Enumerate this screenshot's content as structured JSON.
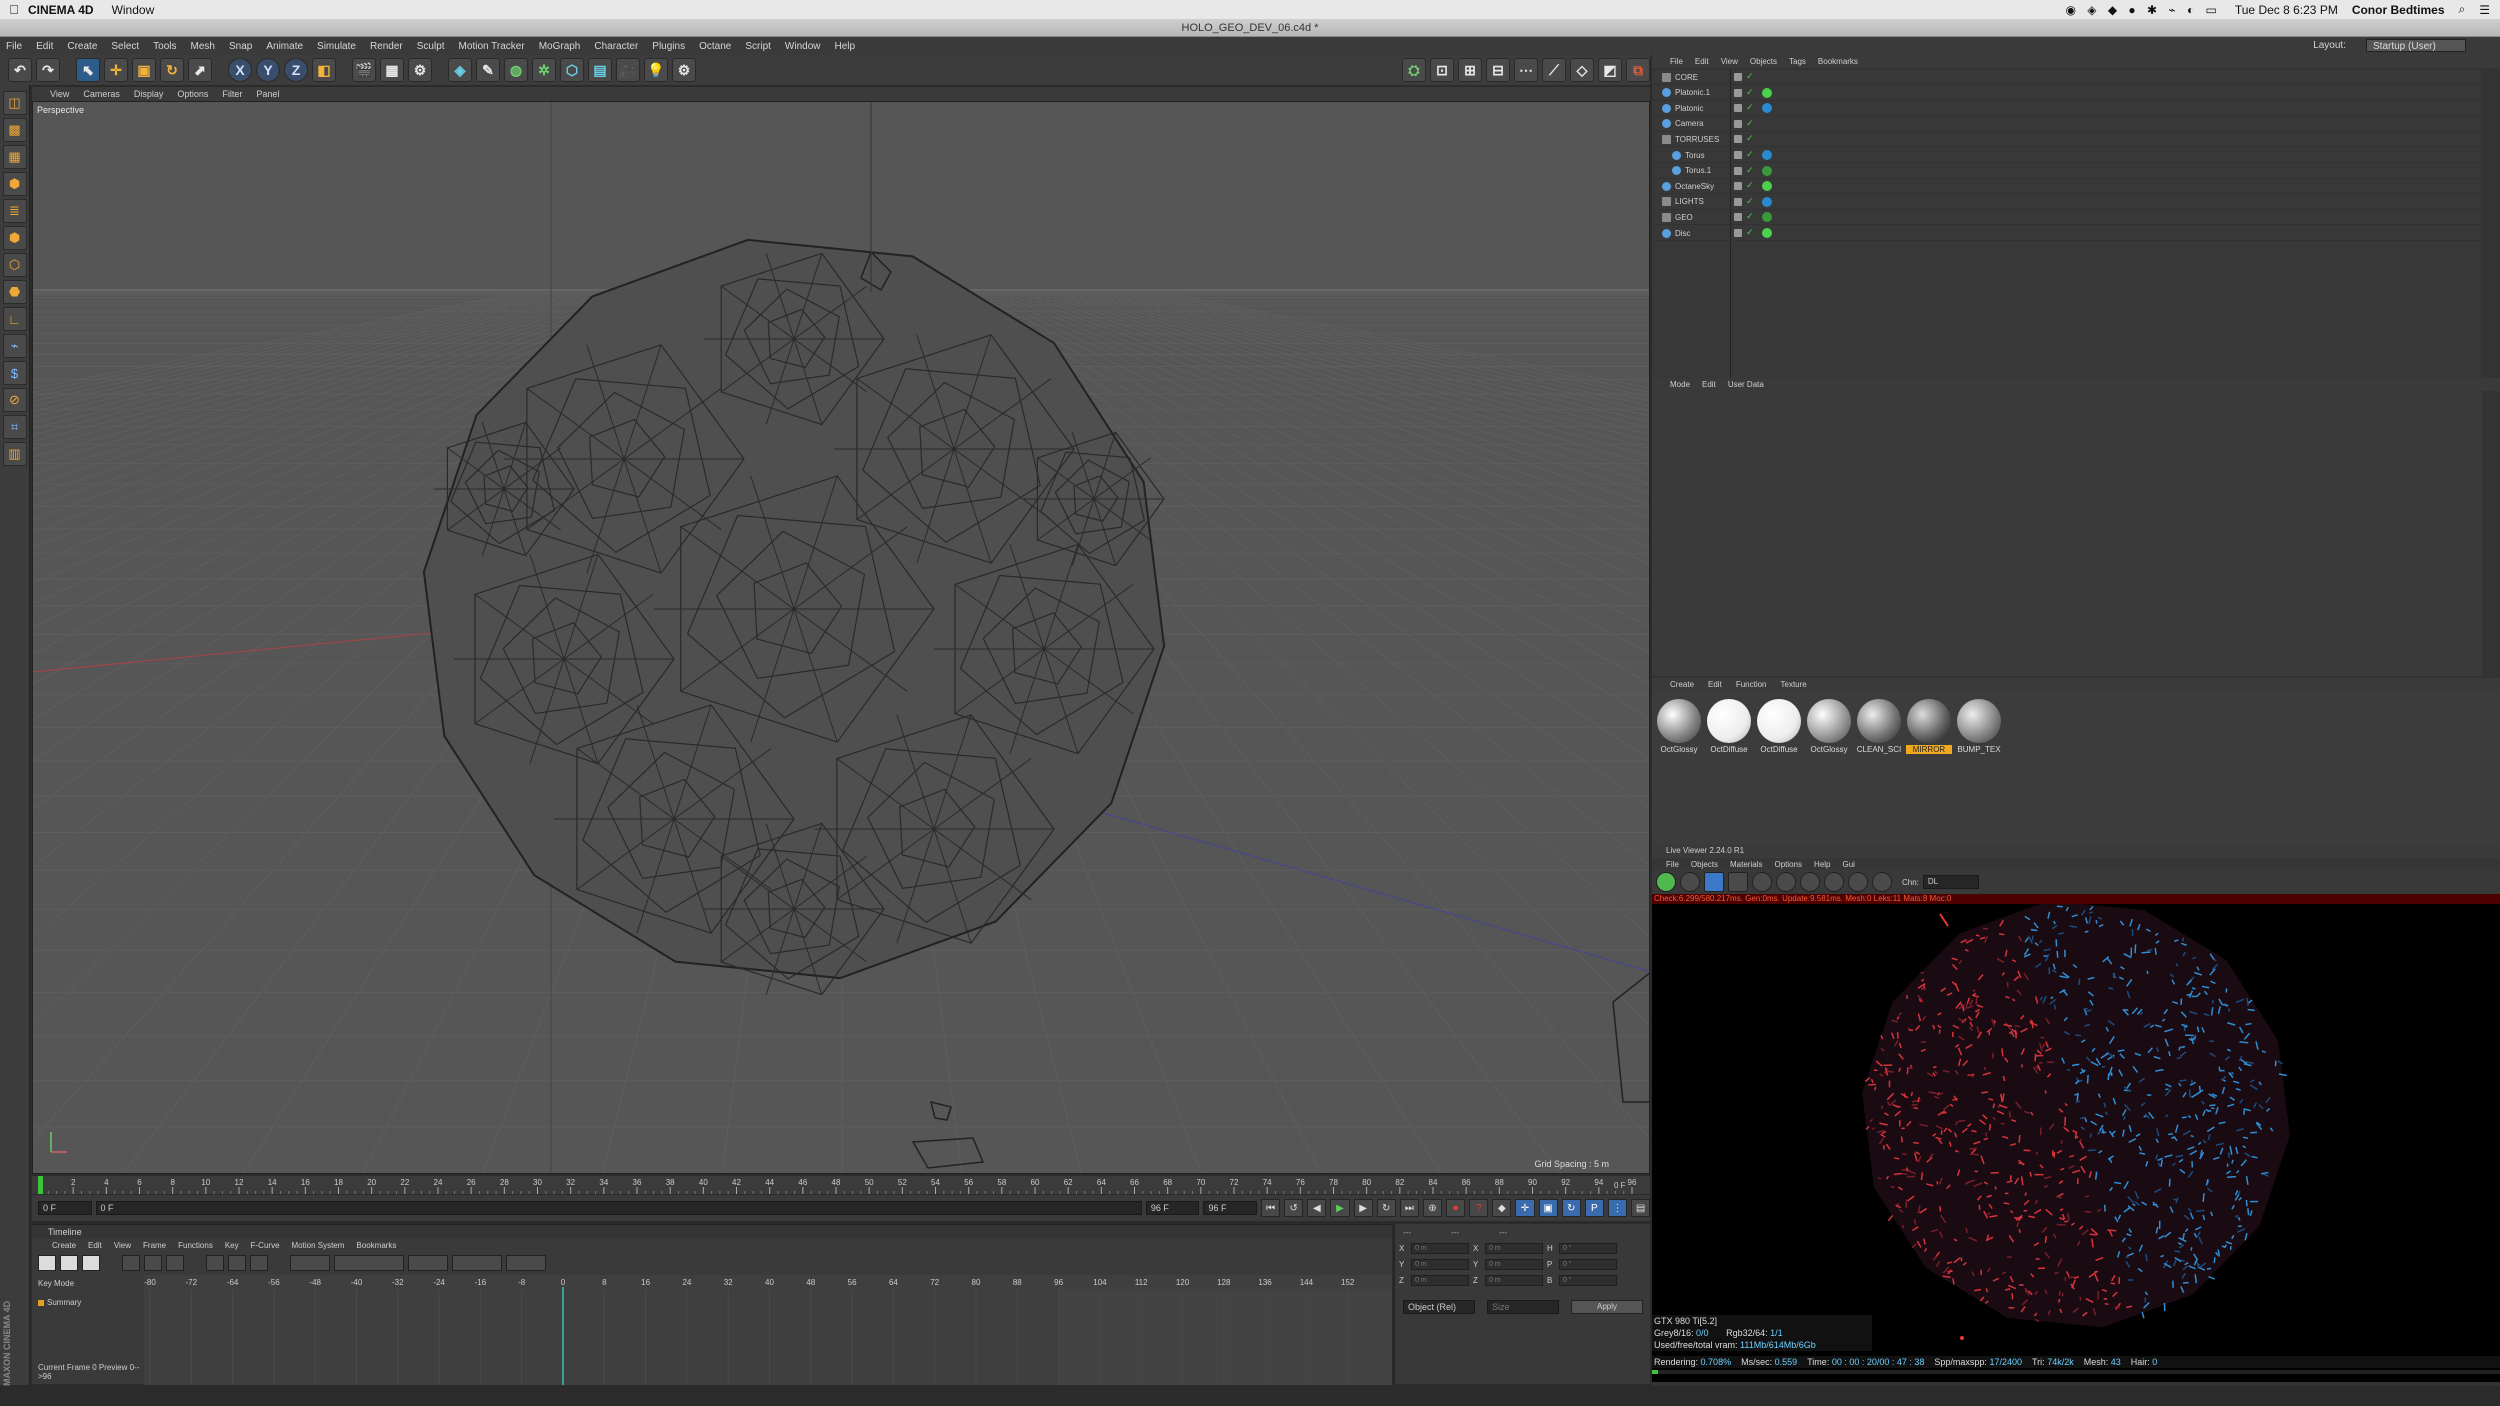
{
  "mac_menu": {
    "apple": "",
    "app": "CINEMA 4D",
    "window": "Window",
    "datetime": "Tue Dec 8  6:23 PM",
    "user": "Conor Bedtimes"
  },
  "window_title": "HOLO_GEO_DEV_06.c4d *",
  "menu": [
    "File",
    "Edit",
    "Create",
    "Select",
    "Tools",
    "Mesh",
    "Snap",
    "Animate",
    "Simulate",
    "Render",
    "Sculpt",
    "Motion Tracker",
    "MoGraph",
    "Character",
    "Plugins",
    "Octane",
    "Script",
    "Window",
    "Help"
  ],
  "layout": {
    "label": "Layout:",
    "value": "Startup (User)"
  },
  "axis_tools": [
    "X",
    "Y",
    "Z"
  ],
  "viewport": {
    "menu": [
      "View",
      "Cameras",
      "Display",
      "Options",
      "Filter",
      "Panel"
    ],
    "label": "Perspective",
    "grid_spacing": "Grid Spacing : 5 m"
  },
  "ruler_ticks": [
    "0",
    "2",
    "4",
    "6",
    "8",
    "10",
    "12",
    "14",
    "16",
    "18",
    "20",
    "22",
    "24",
    "26",
    "28",
    "30",
    "32",
    "34",
    "36",
    "38",
    "40",
    "42",
    "44",
    "46",
    "48",
    "50",
    "52",
    "54",
    "56",
    "58",
    "60",
    "62",
    "64",
    "66",
    "68",
    "70",
    "72",
    "74",
    "76",
    "78",
    "80",
    "82",
    "84",
    "86",
    "88",
    "90",
    "92",
    "94",
    "96"
  ],
  "ruler_end": "0 F",
  "playback": {
    "current": "0 F",
    "slider": "0 F",
    "end": "96 F",
    "max": "96 F"
  },
  "timeline": {
    "title": "Timeline",
    "menu": [
      "Create",
      "Edit",
      "View",
      "Frame",
      "Functions",
      "Key",
      "F-Curve",
      "Motion System",
      "Bookmarks"
    ],
    "mode": "Key Mode",
    "summary": "Summary",
    "ticks": [
      "-80",
      "-72",
      "-64",
      "-56",
      "-48",
      "-40",
      "-32",
      "-24",
      "-16",
      "-8",
      "0",
      "8",
      "16",
      "24",
      "32",
      "40",
      "48",
      "56",
      "64",
      "72",
      "80",
      "88",
      "96",
      "104",
      "112",
      "120",
      "128",
      "136",
      "144",
      "152"
    ],
    "status": "Current Frame  0  Preview  0-->96"
  },
  "coords": {
    "heads": [
      "---",
      "---",
      "---"
    ],
    "rows": [
      [
        "X",
        "0 m",
        "X",
        "0 m",
        "H",
        "0 °"
      ],
      [
        "Y",
        "0 m",
        "Y",
        "0 m",
        "P",
        "0 °"
      ],
      [
        "Z",
        "0 m",
        "Z",
        "0 m",
        "B",
        "0 °"
      ]
    ],
    "mode": "Object (Rel)",
    "size": "Size",
    "apply": "Apply"
  },
  "objects": {
    "menu": [
      "File",
      "Edit",
      "View",
      "Objects",
      "Tags",
      "Bookmarks"
    ],
    "items": [
      {
        "name": "CORE",
        "indent": 0
      },
      {
        "name": "Platonic.1",
        "indent": 0
      },
      {
        "name": "Platonic",
        "indent": 0
      },
      {
        "name": "Camera",
        "indent": 0
      },
      {
        "name": "TORRUSES",
        "indent": 0
      },
      {
        "name": "Torus",
        "indent": 1
      },
      {
        "name": "Torus.1",
        "indent": 1
      },
      {
        "name": "OctaneSky",
        "indent": 0
      },
      {
        "name": "LIGHTS",
        "indent": 0
      },
      {
        "name": "GEO",
        "indent": 0
      },
      {
        "name": "Disc",
        "indent": 0
      }
    ]
  },
  "attributes": {
    "menu": [
      "Mode",
      "Edit",
      "User Data"
    ]
  },
  "materials": {
    "menu": [
      "Create",
      "Edit",
      "Function",
      "Texture"
    ],
    "items": [
      {
        "name": "OctGlossy",
        "selected": false
      },
      {
        "name": "OctDiffuse",
        "selected": false
      },
      {
        "name": "OctDiffuse",
        "selected": false
      },
      {
        "name": "OctGlossy",
        "selected": false
      },
      {
        "name": "CLEAN_SCI",
        "selected": false
      },
      {
        "name": "MIRROR",
        "selected": true
      },
      {
        "name": "BUMP_TEX",
        "selected": false
      }
    ]
  },
  "live_viewer": {
    "title": "Live Viewer 2.24.0 R1",
    "menu": [
      "File",
      "Objects",
      "Materials",
      "Options",
      "Help",
      "Gui"
    ],
    "chn_label": "Chn:",
    "chn_value": "DL",
    "status": "Check:6.299/580.217ms. Gen:0ms. Update:9.581ms. Mesh:0 Leks:11 Mats:8 Moc:0",
    "gpu": "GTX 980 Ti[5.2]",
    "grey": "Grey8/16:",
    "grey_val": "0/0",
    "rgb": "Rgb32/64:",
    "rgb_val": "1/1",
    "vram": "Used/free/total vram:",
    "vram_val": "111Mb/614Mb/6Gb",
    "rendering": "Rendering:",
    "rendering_val": "0.708%",
    "ms": "Ms/sec:",
    "ms_val": "0.559",
    "time": "Time:",
    "time_val": "00 : 00 : 20/00 : 47 : 38",
    "spp": "Spp/maxspp:",
    "spp_val": "17/2400",
    "tri": "Tri:",
    "tri_val": "74k/2k",
    "mesh": "Mesh:",
    "mesh_val": "43",
    "hair": "Hair:",
    "hair_val": "0"
  },
  "maxon_logo": "MAXON CINEMA 4D"
}
